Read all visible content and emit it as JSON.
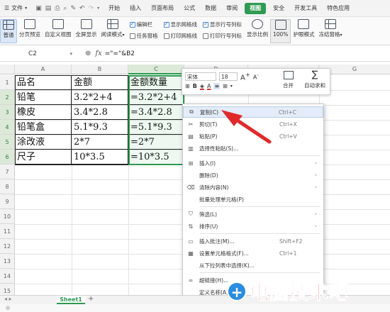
{
  "menubar": {
    "file_label": "文件",
    "tabs": [
      "开始",
      "插入",
      "页面布局",
      "公式",
      "数据",
      "审阅",
      "视图",
      "安全",
      "开发工具",
      "特色应用"
    ],
    "active_tab": "视图"
  },
  "ribbon": {
    "normal": "普通",
    "page_break": "分页预览",
    "custom_view": "自定义视图",
    "fullscreen": "全屏显示",
    "reading_mode": "阅读模式",
    "edit_bar": "编辑栏",
    "task_pane": "任务窗格",
    "show_gridlines": "显示网格线",
    "print_gridlines": "打印网格线",
    "show_headers": "显示行号列标",
    "print_headers": "打印行号列标",
    "zoom_ratio": "显示比例",
    "zoom_100": "100%",
    "eye_mode": "护眼模式",
    "freeze": "冻结窗格"
  },
  "formula_bar": {
    "name_box": "C2",
    "formula": "=\"=\"&B2"
  },
  "grid": {
    "columns": [
      "A",
      "B",
      "C",
      "D",
      "G"
    ],
    "rows": [
      "1",
      "2",
      "3",
      "4",
      "5",
      "6",
      "7",
      "8",
      "9",
      "10",
      "11",
      "12",
      "13",
      "14",
      "15"
    ],
    "cells": [
      [
        "品名",
        "金额",
        "金额数量"
      ],
      [
        "铅笔",
        "3.2*2+4",
        "=3.2*2+4"
      ],
      [
        "橡皮",
        "3.4*2.8",
        "=3.4*2.8"
      ],
      [
        "铅笔盒",
        "5.1*9.3",
        "=5.1*9.3"
      ],
      [
        "涂改液",
        "2*7",
        "=2*7"
      ],
      [
        "尺子",
        "10*3.5",
        "=10*3.5"
      ]
    ]
  },
  "mini_toolbar": {
    "font": "宋体",
    "size": "18",
    "bold": "B",
    "merge": "合并",
    "autosum": "自动求和"
  },
  "context_menu": [
    {
      "label": "复制(C)",
      "shortcut": "Ctrl+C",
      "icon": "copy-icon"
    },
    {
      "label": "剪切(T)",
      "shortcut": "Ctrl+X",
      "icon": "scissors-icon"
    },
    {
      "label": "粘贴(P)",
      "shortcut": "Ctrl+V",
      "icon": "paste-icon"
    },
    {
      "label": "选择性粘贴(S)...",
      "shortcut": "",
      "icon": "paste-special-icon"
    },
    {
      "label": "插入(I)",
      "shortcut": "",
      "icon": "insert-icon"
    },
    {
      "label": "删除(D)",
      "shortcut": "",
      "icon": ""
    },
    {
      "label": "清除内容(N)",
      "shortcut": "",
      "icon": "eraser-icon"
    },
    {
      "label": "批量处理单元格(P)",
      "shortcut": "",
      "icon": ""
    },
    {
      "label": "筛选(L)",
      "shortcut": "",
      "icon": "filter-icon"
    },
    {
      "label": "排序(U)",
      "shortcut": "",
      "icon": "sort-icon"
    },
    {
      "label": "插入批注(M)...",
      "shortcut": "Shift+F2",
      "icon": "comment-icon"
    },
    {
      "label": "设置单元格格式(F)...",
      "shortcut": "Ctrl+1",
      "icon": "format-cells-icon"
    },
    {
      "label": "从下拉列表中选择(K)...",
      "shortcut": "",
      "icon": ""
    },
    {
      "label": "超链接(H)...",
      "shortcut": "",
      "icon": "link-icon"
    },
    {
      "label": "定义名称(A)...",
      "shortcut": "",
      "icon": ""
    }
  ],
  "sheetbar": {
    "sheet_name": "Sheet1",
    "add": "+"
  },
  "watermark": {
    "text": "电脑技术吧"
  },
  "colors": {
    "accent_green": "#2f9a52",
    "arrow_red": "#e02a2a"
  }
}
